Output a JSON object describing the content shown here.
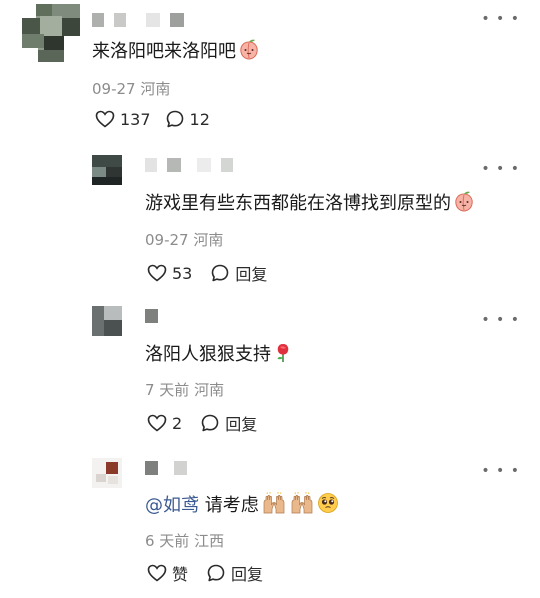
{
  "comments": [
    {
      "text": "来洛阳吧来洛阳吧",
      "emoji": "peach-emoji",
      "date": "09-27",
      "location": "河南",
      "likes": "137",
      "replies": "12"
    },
    {
      "text": "游戏里有些东西都能在洛博找到原型的",
      "emoji": "peach-emoji",
      "date": "09-27",
      "location": "河南",
      "likes": "53",
      "reply_label": "回复"
    },
    {
      "text": "洛阳人狠狠支持",
      "emoji": "rose-emoji",
      "date": "7 天前",
      "location": "河南",
      "likes": "2",
      "reply_label": "回复"
    },
    {
      "mention": "@如鸢",
      "text": "请考虑",
      "emojis": [
        "raising-hands-emoji",
        "raising-hands-emoji",
        "pleading-face-emoji"
      ],
      "date": "6 天前",
      "location": "江西",
      "like_label": "赞",
      "reply_label": "回复"
    }
  ],
  "more_icon": "more-dots-icon",
  "colors": {
    "text": "#1a1a1a",
    "meta": "#8c8c8c",
    "mention": "#3a5a92",
    "icon": "#2b2b2b"
  }
}
